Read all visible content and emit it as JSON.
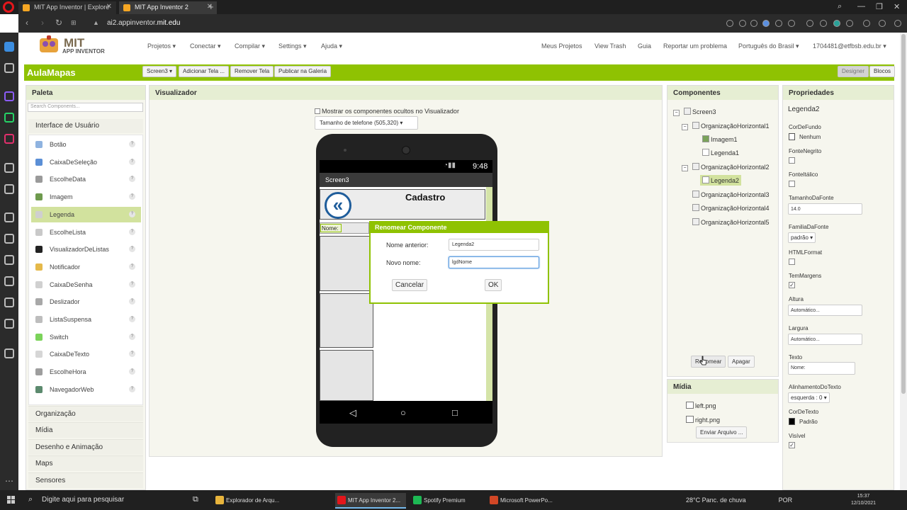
{
  "browser": {
    "tabs": [
      {
        "title": "MIT App Inventor | Explore",
        "active": false
      },
      {
        "title": "MIT App Inventor 2",
        "active": true
      }
    ],
    "url_prefix": "ai2.appinventor.",
    "url_domain": "mit.edu"
  },
  "header": {
    "logo_title": "MIT",
    "logo_subtitle": "APP INVENTOR",
    "menu_left": [
      "Projetos ▾",
      "Conectar ▾",
      "Compilar ▾",
      "Settings ▾",
      "Ajuda ▾"
    ],
    "menu_right": [
      "Meus Projetos",
      "View Trash",
      "Guia",
      "Reportar um problema",
      "Português do Brasil ▾",
      "1704481@etfbsb.edu.br ▾"
    ]
  },
  "toolbar": {
    "project_name": "AulaMapas",
    "screen_select": "Screen3 ▾",
    "add_screen": "Adicionar Tela ...",
    "remove_screen": "Remover Tela",
    "publish": "Publicar na Galeria",
    "designer": "Designer",
    "blocks": "Blocos"
  },
  "palette": {
    "title": "Paleta",
    "search_placeholder": "Search Components...",
    "open_category": "Interface de Usuário",
    "items": [
      {
        "label": "Botão",
        "color": "#8fb3e0"
      },
      {
        "label": "CaixaDeSeleção",
        "color": "#5b8fd6"
      },
      {
        "label": "EscolheData",
        "color": "#9a9a9a"
      },
      {
        "label": "Imagem",
        "color": "#6e9a4e"
      },
      {
        "label": "Legenda",
        "color": "#cfcfcf",
        "selected": true
      },
      {
        "label": "EscolheLista",
        "color": "#c9c9c9"
      },
      {
        "label": "VisualizadorDeListas",
        "color": "#222222"
      },
      {
        "label": "Notificador",
        "color": "#e5b94a"
      },
      {
        "label": "CaixaDeSenha",
        "color": "#d0d0d0"
      },
      {
        "label": "Deslizador",
        "color": "#a8a8a8"
      },
      {
        "label": "ListaSuspensa",
        "color": "#bdbdbd"
      },
      {
        "label": "Switch",
        "color": "#7bd35a"
      },
      {
        "label": "CaixaDeTexto",
        "color": "#d6d6d6"
      },
      {
        "label": "EscolheHora",
        "color": "#9e9e9e"
      },
      {
        "label": "NavegadorWeb",
        "color": "#5c8a6e"
      }
    ],
    "help_glyph": "?",
    "categories": [
      "Organização",
      "Mídia",
      "Desenho e Animação",
      "Maps",
      "Sensores"
    ]
  },
  "viewer": {
    "title": "Visualizador",
    "show_hidden_label": "Mostrar os componentes ocultos no Visualizador",
    "phone_size": "Tamanho de telefone (505,320) ▾",
    "status_time": "9:48",
    "screen_title": "Screen3",
    "back_glyph": "«",
    "cadastro": "Cadastro",
    "nome_label": "Nome:"
  },
  "dialog": {
    "title": "Renomear Componente",
    "old_name_label": "Nome anterior:",
    "old_name_value": "Legenda2",
    "new_name_label": "Novo nome:",
    "new_name_value": "lgdNome",
    "cancel": "Cancelar",
    "ok": "OK"
  },
  "components": {
    "title": "Componentes",
    "tree": [
      {
        "label": "Screen3",
        "depth": 0,
        "toggle": "−",
        "icon": "screen"
      },
      {
        "label": "OrganizaçãoHorizontal1",
        "depth": 1,
        "toggle": "−",
        "icon": "layout"
      },
      {
        "label": "Imagem1",
        "depth": 2,
        "icon": "img"
      },
      {
        "label": "Legenda1",
        "depth": 2,
        "icon": "lbl"
      },
      {
        "label": "OrganizaçãoHorizontal2",
        "depth": 1,
        "toggle": "−",
        "icon": "layout"
      },
      {
        "label": "Legenda2",
        "depth": 2,
        "icon": "lbl",
        "selected": true
      },
      {
        "label": "OrganizaçãoHorizontal3",
        "depth": 1,
        "icon": "layout"
      },
      {
        "label": "OrganizaçãoHorizontal4",
        "depth": 1,
        "icon": "layout"
      },
      {
        "label": "OrganizaçãoHorizontal5",
        "depth": 1,
        "icon": "layout"
      }
    ],
    "rename_button": "Renomear",
    "delete_button": "Apagar"
  },
  "media": {
    "title": "Mídia",
    "files": [
      "left.png",
      "right.png"
    ],
    "upload_button": "Enviar Arquivo ..."
  },
  "properties": {
    "title": "Propriedades",
    "component": "Legenda2",
    "bg_color_label": "CorDeFundo",
    "bg_color_value": "Nenhum",
    "bold_label": "FonteNegrito",
    "italic_label": "FonteItálico",
    "font_size_label": "TamanhoDaFonte",
    "font_size_value": "14.0",
    "font_family_label": "FamiliaDaFonte",
    "font_family_value": "padrão ▾",
    "html_label": "HTMLFormat",
    "margins_label": "TemMargens",
    "height_label": "Altura",
    "height_value": "Automático...",
    "width_label": "Largura",
    "width_value": "Automático...",
    "text_label": "Texto",
    "text_value": "Nome:",
    "align_label": "AlinhamentoDoTexto",
    "align_value": "esquerda : 0 ▾",
    "text_color_label": "CorDeTexto",
    "text_color_value": "Padrão",
    "visible_label": "Visível",
    "check_glyph": "✓"
  },
  "taskbar": {
    "search_placeholder": "Digite aqui para pesquisar",
    "apps": [
      {
        "label": "Explorador de Arqu...",
        "color": "#e8b43c"
      },
      {
        "label": "MIT App Inventor 2...",
        "color": "#e4161b",
        "active": true
      },
      {
        "label": "Spotify Premium",
        "color": "#1db954"
      },
      {
        "label": "Microsoft PowerPo...",
        "color": "#d24726"
      }
    ],
    "weather": "28°C  Panc. de chuva",
    "lang": "POR",
    "time": "15:37",
    "date": "12/10/2021"
  },
  "colors": {
    "accent_green": "#8fc202",
    "selection": "#d2e29e",
    "panel_bg": "#f6f6ee"
  }
}
